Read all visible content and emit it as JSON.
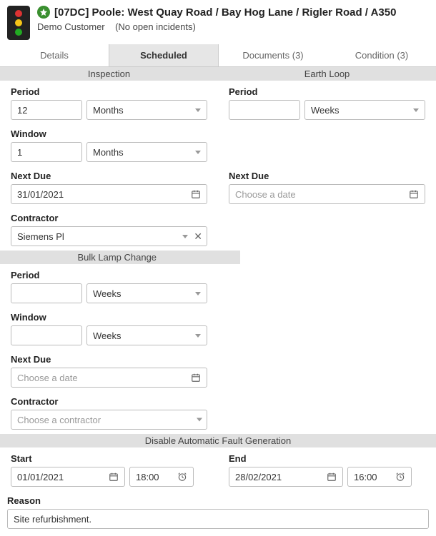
{
  "header": {
    "title": "[07DC] Poole: West Quay Road / Bay Hog Lane / Rigler Road / A350",
    "customer": "Demo Customer",
    "incidents": "(No open incidents)"
  },
  "tabs": {
    "details": "Details",
    "scheduled": "Scheduled",
    "documents": "Documents (3)",
    "condition": "Condition (3)"
  },
  "sections": {
    "inspection": "Inspection",
    "earth_loop": "Earth Loop",
    "bulk_lamp": "Bulk Lamp Change",
    "disable_fault": "Disable Automatic Fault Generation"
  },
  "labels": {
    "period": "Period",
    "window": "Window",
    "next_due": "Next Due",
    "contractor": "Contractor",
    "start": "Start",
    "end": "End",
    "reason": "Reason"
  },
  "units": {
    "months": "Months",
    "weeks": "Weeks"
  },
  "placeholders": {
    "choose_date": "Choose a date",
    "choose_contractor": "Choose a contractor"
  },
  "inspection": {
    "period_value": "12",
    "period_unit": "Months",
    "window_value": "1",
    "window_unit": "Months",
    "next_due": "31/01/2021",
    "contractor": "Siemens Pl"
  },
  "earth_loop": {
    "period_value": "",
    "period_unit": "Weeks",
    "next_due": ""
  },
  "bulk_lamp": {
    "period_value": "",
    "period_unit": "Weeks",
    "window_value": "",
    "window_unit": "Weeks",
    "next_due": "",
    "contractor": ""
  },
  "disable": {
    "start_date": "01/01/2021",
    "start_time": "18:00",
    "end_date": "28/02/2021",
    "end_time": "16:00",
    "reason": "Site refurbishment."
  }
}
